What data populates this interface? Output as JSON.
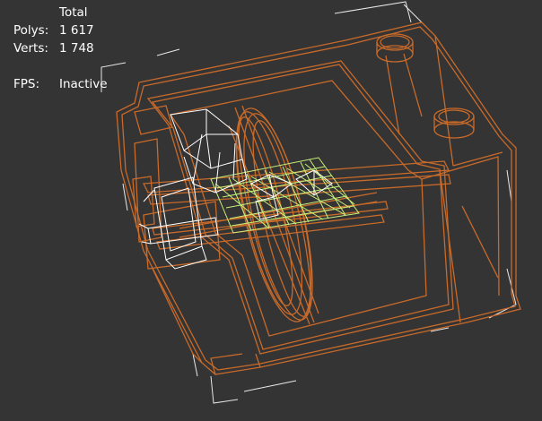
{
  "viewport": {
    "background": "#343434",
    "wire_color": "#c86a2a",
    "selected_color": "#ffffff",
    "grid_color": "#c8f07a",
    "bbox_color": "#e8e8e8"
  },
  "statistics": {
    "header": "Total",
    "polys_label": "Polys:",
    "polys_value": "1 617",
    "verts_label": "Verts:",
    "verts_value": "1 748",
    "fps_label": "FPS:",
    "fps_value": "Inactive"
  }
}
